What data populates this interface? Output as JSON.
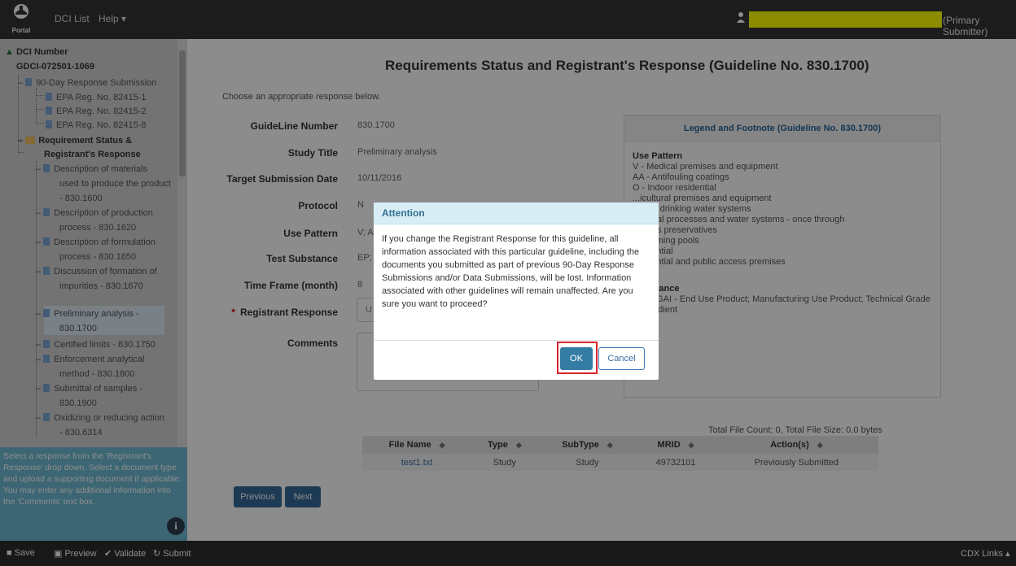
{
  "topbar": {
    "logo_text": "Portal",
    "nav": [
      "DCI List",
      "Help ▾"
    ],
    "primary": "(Primary Submitter)"
  },
  "sidebar": {
    "root_label": "DCI Number",
    "dci_number": "GDCI-072501-1069",
    "items": [
      {
        "label": "90-Day Response Submission"
      },
      {
        "label": "EPA Reg. No. 82415-1"
      },
      {
        "label": "EPA Reg. No. 82415-2"
      },
      {
        "label": "EPA Reg. No. 82415-8"
      },
      {
        "label": "Requirement Status &"
      },
      {
        "label": "Registrant's Response"
      },
      {
        "label": "Description of materials"
      },
      {
        "label": "used to produce the product"
      },
      {
        "label": "- 830.1600"
      },
      {
        "label": "Description of production"
      },
      {
        "label": "process - 830.1620"
      },
      {
        "label": "Description of formulation"
      },
      {
        "label": "process - 830.1650"
      },
      {
        "label": "Discussion of formation of"
      },
      {
        "label": "impurities - 830.1670"
      },
      {
        "label": "Preliminary analysis -"
      },
      {
        "label": "830.1700"
      },
      {
        "label": "Certified limits - 830.1750"
      },
      {
        "label": "Enforcement analytical"
      },
      {
        "label": "method - 830.1800"
      },
      {
        "label": "Submittal of samples -"
      },
      {
        "label": "830.1900"
      },
      {
        "label": "Oxidizing or reducing action"
      },
      {
        "label": "- 830.6314"
      }
    ],
    "help_text": "Select a response from the 'Registrant's Response' drop down. Select a document type and upload a supporting document if applicable. You may enter any additional information into the 'Comments' text box."
  },
  "main": {
    "title": "Requirements Status and Registrant's Response (Guideline No. 830.1700)",
    "instruction": "Choose an appropriate response below.",
    "fields": [
      {
        "label": "GuideLine Number",
        "value": "830.1700"
      },
      {
        "label": "Study Title",
        "value": "Preliminary analysis"
      },
      {
        "label": "Target Submission Date",
        "value": "10/11/2016"
      },
      {
        "label": "Protocol",
        "value": "N"
      },
      {
        "label": "Use Pattern",
        "value": "V; A"
      },
      {
        "label": "Test Substance",
        "value": "EP; I"
      },
      {
        "label": "Time Frame (month)",
        "value": "8"
      },
      {
        "label": "Registrant Response",
        "value": "U"
      },
      {
        "label": "Comments",
        "value": ""
      }
    ],
    "required_mark": "*",
    "legend": {
      "title": "Legend and Footnote (Guideline No. 830.1700)",
      "use_pattern_head": "Use Pattern",
      "use_pattern_lines": [
        "V - Medical premises and equipment",
        "AA - Antifouling coatings",
        "O - Indoor residential",
        "...icultural premises and equipment",
        "...man drinking water systems",
        "...ustrial processes and water systems - once through",
        "...erials preservatives",
        "...wimming pools",
        "...sidential",
        "...sidential and public access premises"
      ],
      "substance_head": "...ubstance",
      "substance_lines": [
        "...P; TGAI - End Use Product; Manufacturing Use Product; Technical Grade",
        "...ngredient"
      ]
    },
    "table": {
      "summary": "Total File Count: 0, Total File Size: 0.0 bytes",
      "headers": [
        "File Name",
        "Type",
        "SubType",
        "MRID",
        "Action(s)"
      ],
      "rows": [
        [
          "test1.txt",
          "Study",
          "Study",
          "49732101",
          "Previously Submitted"
        ]
      ]
    },
    "prev_label": "Previous",
    "next_label": "Next"
  },
  "bottombar": {
    "save": "Save",
    "preview": "Preview",
    "validate": "Validate",
    "submit": "Submit",
    "cdx": "CDX Links ▴"
  },
  "modal": {
    "title": "Attention",
    "body": "If you change the Registrant Response for this guideline, all information associated with this particular guideline, including the documents you submitted as part of previous 90-Day Response Submissions and/or Data Submissions, will be lost. Information associated with other guidelines will remain unaffected. Are you sure you want to proceed?",
    "ok": "OK",
    "cancel": "Cancel"
  }
}
